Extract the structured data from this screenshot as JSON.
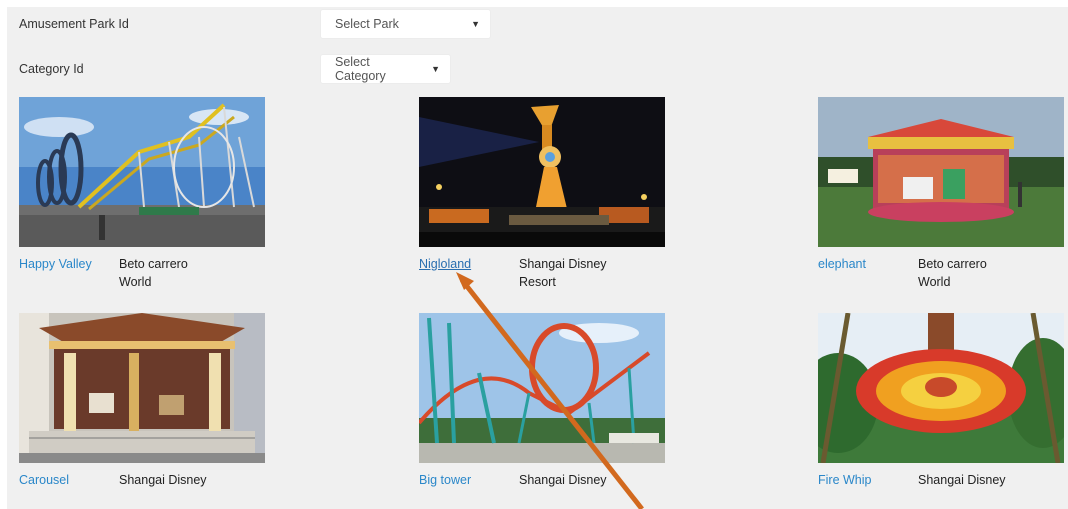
{
  "filters": {
    "park_label": "Amusement Park Id",
    "park_select": "Select Park",
    "category_label": "Category Id",
    "category_select": "Select Category"
  },
  "rides": [
    {
      "name": "Happy Valley",
      "park": "Beto carrero World",
      "image": "roller-coaster-loops"
    },
    {
      "name": "Nigloland",
      "park": "Shangai Disney Resort",
      "image": "night-spinning-tower"
    },
    {
      "name": "elephant",
      "park": "Beto carrero World",
      "image": "illuminated-carousel"
    },
    {
      "name": "Carousel",
      "park": "Shangai Disney",
      "image": "vintage-carousel"
    },
    {
      "name": "Big tower",
      "park": "Shangai Disney",
      "image": "red-loop-coaster"
    },
    {
      "name": "Fire Whip",
      "park": "Shangai Disney",
      "image": "swinging-ring-ride"
    }
  ],
  "colors": {
    "link": "#2a87c9",
    "annotation_arrow": "#d2691e",
    "panel_bg": "#f0f0f0"
  }
}
